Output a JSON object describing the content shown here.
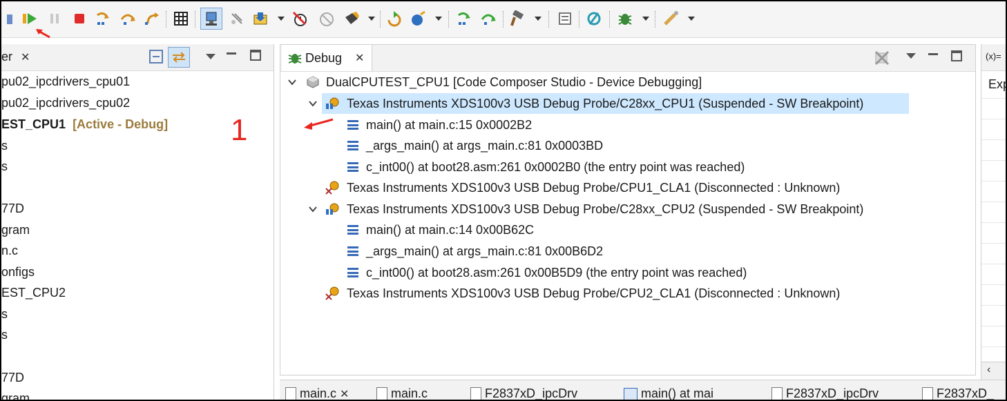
{
  "toolbar": {
    "icons": [
      "debug-dropdown-icon",
      "resume-icon",
      "suspend-icon",
      "terminate-icon",
      "step-into-icon",
      "step-over-icon",
      "step-return-icon",
      "memory-browser-icon",
      "connect-target-icon",
      "disconnect-target-icon",
      "load-program-icon",
      "remove-breakpoints-icon",
      "skip-breakpoints-icon",
      "new-breakpoint-icon",
      "restart-icon",
      "reset-cpu-icon",
      "assembly-step-into-icon",
      "assembly-step-over-icon",
      "build-icon",
      "expressions-icon",
      "view-expressions-icon",
      "debug-perspective-icon",
      "tools-icon"
    ]
  },
  "left_panel": {
    "tab_label": "er",
    "rows": [
      {
        "text": "pu02_ipcdrivers_cpu01",
        "bold": false
      },
      {
        "text": "pu02_ipcdrivers_cpu02",
        "bold": false
      },
      {
        "text": "EST_CPU1",
        "bold": true,
        "suffix": "[Active - Debug]"
      },
      {
        "text": "s",
        "bold": false
      },
      {
        "text": "s",
        "bold": false
      },
      {
        "text": "",
        "bold": false
      },
      {
        "text": "77D",
        "bold": false
      },
      {
        "text": "gram",
        "bold": false
      },
      {
        "text": "n.c",
        "bold": false
      },
      {
        "text": "onfigs",
        "bold": false
      },
      {
        "text": "EST_CPU2",
        "bold": false
      },
      {
        "text": "s",
        "bold": false
      },
      {
        "text": "s",
        "bold": false
      },
      {
        "text": "",
        "bold": false
      },
      {
        "text": "77D",
        "bold": false
      },
      {
        "text": "gram",
        "bold": false
      }
    ]
  },
  "annotation": {
    "label": "1",
    "color": "#e8261e"
  },
  "debug_view": {
    "tab_label": "Debug",
    "rows": [
      {
        "text": "DualCPUTEST_CPU1 [Code Composer Studio - Device Debugging]",
        "icon": "launch-config-icon"
      },
      {
        "text": "Texas Instruments XDS100v3 USB Debug Probe/C28xx_CPU1 (Suspended - SW Breakpoint)",
        "icon": "suspended-thread-icon"
      },
      {
        "text": "main() at main.c:15 0x0002B2",
        "icon": "stack-frame-icon"
      },
      {
        "text": "_args_main() at args_main.c:81 0x0003BD",
        "icon": "stack-frame-icon"
      },
      {
        "text": "c_int00() at boot28.asm:261 0x0002B0  (the entry point was reached)",
        "icon": "stack-frame-icon"
      },
      {
        "text": "Texas Instruments XDS100v3 USB Debug Probe/CPU1_CLA1 (Disconnected : Unknown)",
        "icon": "disconnected-thread-icon"
      },
      {
        "text": "Texas Instruments XDS100v3 USB Debug Probe/C28xx_CPU2 (Suspended - SW Breakpoint)",
        "icon": "suspended-thread-icon"
      },
      {
        "text": "main() at main.c:14 0x00B62C",
        "icon": "stack-frame-icon"
      },
      {
        "text": "_args_main() at args_main.c:81 0x00B6D2",
        "icon": "stack-frame-icon"
      },
      {
        "text": "c_int00() at boot28.asm:261 0x00B5D9  (the entry point was reached)",
        "icon": "stack-frame-icon"
      },
      {
        "text": "Texas Instruments XDS100v3 USB Debug Probe/CPU2_CLA1 (Disconnected : Unknown)",
        "icon": "disconnected-thread-icon"
      }
    ]
  },
  "right_panel": {
    "tab_label": "(x)=",
    "header": "Exp"
  },
  "bottom_tabs": [
    {
      "label": "main.c",
      "icon": "c-file-icon"
    },
    {
      "label": "main.c",
      "icon": "c-file-icon"
    },
    {
      "label": "F2837xD_ipcDrv",
      "icon": "h-file-icon"
    },
    {
      "label": "main() at mai",
      "icon": "disassembly-icon"
    },
    {
      "label": "F2837xD_ipcDrv",
      "icon": "h-file-icon"
    },
    {
      "label": "F2837xD_",
      "icon": "h-file-icon"
    }
  ],
  "colors": {
    "accent_highlight": "#cde8ff",
    "active_label": "#9b7b3c",
    "annotation_red": "#e8261e"
  }
}
